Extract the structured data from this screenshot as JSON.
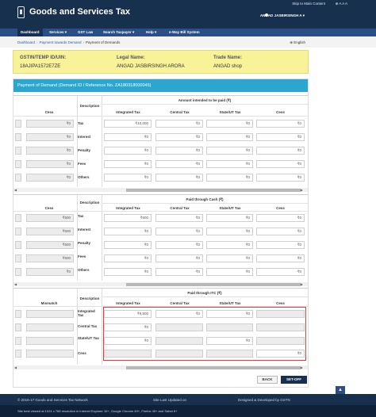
{
  "header": {
    "skip_link": "Skip to Main Content",
    "top_links": "⊕ A A A",
    "title": "Goods and Services Tax",
    "user": "ANGAD JASBIRSINGH A ▾"
  },
  "nav": {
    "items": [
      {
        "label": "Dashboard"
      },
      {
        "label": "Services ▾"
      },
      {
        "label": "GST Law"
      },
      {
        "label": "Search Taxpayer ▾"
      },
      {
        "label": "Help ▾"
      },
      {
        "label": "e-Way Bill System"
      }
    ]
  },
  "breadcrumb": {
    "items": [
      "Dashboard",
      "Payment towards Demand",
      "Payment of Demands"
    ],
    "separator": "›"
  },
  "language": "⊕ English",
  "taxpayer": {
    "gstin_label": "GSTIN/TEMP ID/UIN:",
    "gstin_value": "18AJIPA1572E7ZE",
    "legal_label": "Legal Name:",
    "legal_value": "ANGAD JASBIRSINGH ARORA",
    "trade_label": "Trade Name:",
    "trade_value": "ANGAD shop"
  },
  "panel": {
    "title": "Payment of Demand (Demand ID / Reference No. ZA180318000045)"
  },
  "section1": {
    "group_header": "Amount intended to be paid (₹)",
    "left_header": "Cess",
    "desc_header": "Description",
    "columns": [
      "Integrated Tax",
      "Central Tax",
      "State/UT Tax",
      "Cess"
    ],
    "rows": [
      {
        "label": "Tax",
        "left": "₹0",
        "values": [
          "₹10,000",
          "₹0",
          "₹0",
          "₹0"
        ]
      },
      {
        "label": "Interest",
        "left": "₹0",
        "values": [
          "₹0",
          "₹0",
          "₹0",
          "₹0"
        ]
      },
      {
        "label": "Penalty",
        "left": "₹0",
        "values": [
          "₹0",
          "₹0",
          "₹0",
          "₹0"
        ]
      },
      {
        "label": "Fees",
        "left": "₹0",
        "values": [
          "₹0",
          "₹0",
          "₹0",
          "₹0"
        ]
      },
      {
        "label": "Others",
        "left": "₹0",
        "values": [
          "₹0",
          "₹0",
          "₹0",
          "₹0"
        ]
      }
    ]
  },
  "section2": {
    "group_header": "Paid through Cash (₹)",
    "left_header": "Cess",
    "desc_header": "Description",
    "columns": [
      "Integrated Tax",
      "Central Tax",
      "State/UT Tax",
      "Cess"
    ],
    "rows": [
      {
        "label": "Tax",
        "left": "₹500",
        "values": [
          "₹500",
          "₹0",
          "₹0",
          "₹0"
        ]
      },
      {
        "label": "Interest",
        "left": "₹500",
        "values": [
          "₹0",
          "₹0",
          "₹0",
          "₹0"
        ]
      },
      {
        "label": "Penalty",
        "left": "₹500",
        "values": [
          "₹0",
          "₹0",
          "₹0",
          "₹0"
        ]
      },
      {
        "label": "Fees",
        "left": "₹500",
        "values": [
          "₹0",
          "₹0",
          "₹0",
          "₹0"
        ]
      },
      {
        "label": "Others",
        "left": "₹0",
        "values": [
          "₹0",
          "₹0",
          "₹0",
          "₹0"
        ]
      }
    ]
  },
  "section3": {
    "group_header": "Paid through ITC (₹)",
    "left_header": "Mismatch",
    "desc_header": "Description",
    "columns": [
      "Integrated Tax",
      "Central Tax",
      "State/UT Tax",
      "Cess"
    ],
    "rows": [
      {
        "label": "Integrated Tax",
        "values": [
          "₹9,500",
          "₹0",
          "₹0",
          ""
        ]
      },
      {
        "label": "Central Tax",
        "values": [
          "₹0",
          "",
          "",
          ""
        ]
      },
      {
        "label": "State/UT Tax",
        "values": [
          "₹0",
          "",
          "₹0",
          ""
        ]
      },
      {
        "label": "Cess",
        "values": [
          "",
          "",
          "",
          "₹0"
        ]
      }
    ]
  },
  "scroll": {
    "left": "◀",
    "right": "▶"
  },
  "buttons": {
    "back": "BACK",
    "setoff": "SET-OFF"
  },
  "footer": {
    "copyright": "© 2016-17 Goods and Services Tax Network",
    "updated": "Site Last Updated on",
    "designed": "Designed & Developed by GSTN",
    "best_viewed": "Site best viewed at 1024 x 768 resolution in Internet Explorer 10+, Google Chrome 49+, Firefox 45+ and Safari 6+"
  },
  "colors": {
    "header": "#17304e",
    "nav": "#2c4e86",
    "panel_head": "#2aa6cf",
    "info_box": "#f8f299",
    "highlight": "#e23b3b"
  }
}
